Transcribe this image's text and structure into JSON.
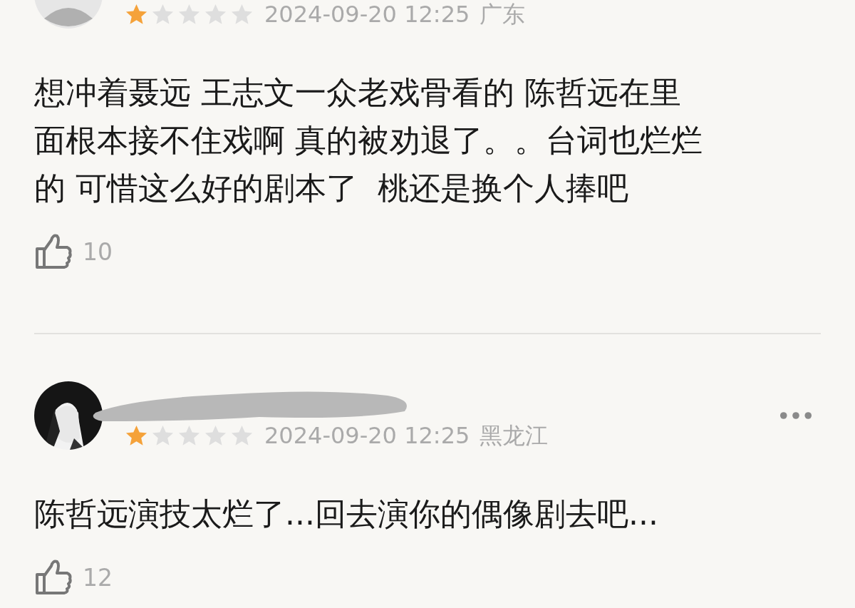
{
  "reviews": [
    {
      "avatar": {
        "kind": "default"
      },
      "stars": 1,
      "time": "2024-09-20 12:25",
      "region": "广东",
      "text_lines": [
        "想冲着聂远 王志文一众老戏骨看的 陈哲远在里",
        "面根本接不住戏啊 真的被劝退了。。台词也烂烂",
        "的 可惜这么好的剧本了  桃还是换个人捧吧"
      ],
      "likes": "10"
    },
    {
      "avatar": {
        "kind": "picture"
      },
      "username_redacted": true,
      "stars": 1,
      "time": "2024-09-20 12:25",
      "region": "黑龙江",
      "menu": true,
      "text_lines": [
        "陈哲远演技太烂了...回去演你的偶像剧去吧..."
      ],
      "likes": "12"
    }
  ]
}
